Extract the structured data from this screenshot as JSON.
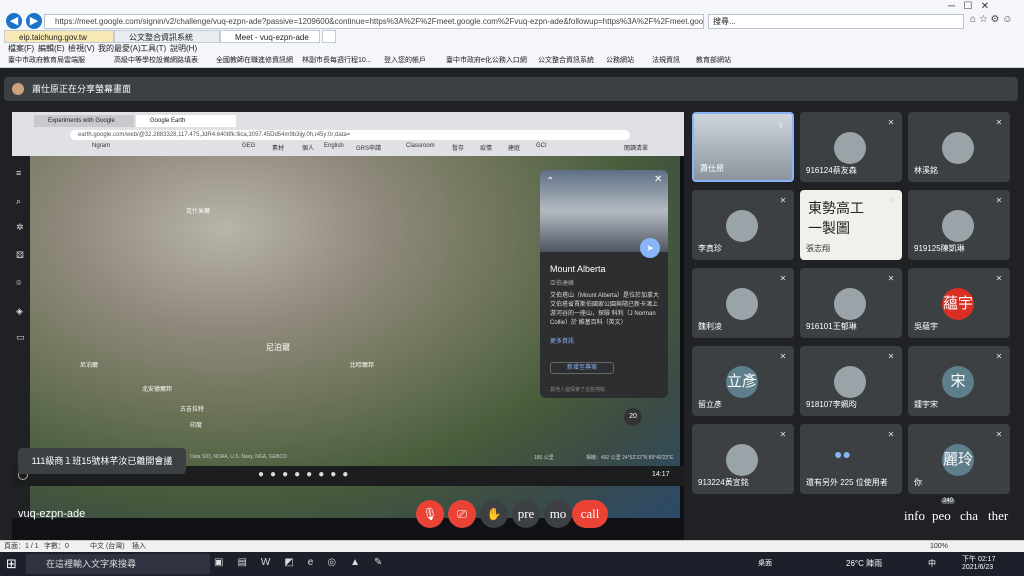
{
  "browser": {
    "url": "https://meet.google.com/signin/v2/challenge/vuq-ezpn-ade?passive=1209600&continue=https%3A%2F%2Fmeet.google.com%2Fvuq-ezpn-ade&followup=https%3A%2F%2Fmeet.google.com%2Fvuq-ezpn",
    "search_placeholder": "搜尋...",
    "tabs": [
      "eip.taichung.gov.tw",
      "公文整合資訊系統",
      "Meet - vuq-ezpn-ade"
    ],
    "menu": [
      "檔案(F)",
      "編輯(E)",
      "檢視(V)",
      "我的最愛(A)",
      "工具(T)",
      "說明(H)"
    ],
    "favorites": [
      "臺中市政府教育局雲端服",
      "高級中等學校設備網路填表",
      "全國教師在職進修資訊網",
      "林副市長每週行程10...",
      "登入您的帳戶",
      "臺中市政府e化公務入口網",
      "公文整合資訊系統",
      "公務網站",
      "法規資訊",
      "教育部網站"
    ]
  },
  "meet": {
    "sharing_banner": "蕭仕原正在分享螢幕畫面",
    "meeting_code": "vuq-ezpn-ade",
    "toast": "111級商１班15號林芊汝已離開會議",
    "controls": {
      "present": "pre",
      "more": "mo",
      "call": "call"
    },
    "right_labels": {
      "info": "info",
      "people": "peo",
      "chat": "cha",
      "others": "ther",
      "people_count": "240"
    }
  },
  "shared_screen": {
    "tabs": [
      "Experiments with Google",
      "Google Earth"
    ],
    "url": "earth.google.com/web/@32.2883328,117.475,JdR4.6408fk:llica,3057.45Dd54m9b3ijy,0h,r45y:0r;data=",
    "bookmarks": [
      "Ngram",
      "GEG",
      "素材",
      "個人",
      "English",
      "GRS申請",
      "Classroom",
      "暫存",
      "疫情",
      "建庭",
      "GCI",
      "閱讀清單"
    ],
    "map_labels": [
      "尼泊爾",
      "比哈爾邦",
      "北安德爾邦",
      "印度",
      "尼泊爾",
      "古吉拉特",
      "克什米爾"
    ],
    "card": {
      "title": "Mount Alberta",
      "subtitle": "亞伯達峰",
      "body": "艾伯塔山（Mount Alberta）是位於加拿大艾伯塔省賈斯伯國家公園與隨已新卡鴻上游河谷的一座山，探險 科利（J Norman Collie）於 維基百科（英文）",
      "more": "更多資訊",
      "add_btn": "新增至專案",
      "footer": "其他人還探索了這些地點"
    },
    "attribution": "Data SIO, NOAA, U.S. Navy, NGA, GEBCO",
    "scale": "180 公里",
    "coords": "相機：492 公里  24°52'22\"N 89°49'23\"E",
    "zoom_level": "20",
    "time": "14:17"
  },
  "participants": [
    {
      "name": "蕭仕原",
      "type": "video",
      "active": true
    },
    {
      "name": "916124蔡友森",
      "type": "photo"
    },
    {
      "name": "林溪銘",
      "type": "photo"
    },
    {
      "name": "李真珍",
      "type": "photo"
    },
    {
      "name": "張志翔",
      "type": "video",
      "content": "東勢高工\n一製圖"
    },
    {
      "name": "919125陳凱琳",
      "type": "photo"
    },
    {
      "name": "魏利凌",
      "type": "photo"
    },
    {
      "name": "916101王郁琳",
      "type": "photo"
    },
    {
      "name": "吳蘊宇",
      "type": "avatar",
      "initial": "蘊宇",
      "color": "#d93025"
    },
    {
      "name": "留立彥",
      "type": "avatar",
      "initial": "立彥",
      "color": "#5f7e8c"
    },
    {
      "name": "918107李姵昀",
      "type": "photo"
    },
    {
      "name": "鍾宇宋",
      "type": "avatar",
      "initial": "宋",
      "color": "#5f7e8c"
    },
    {
      "name": "913224黃宣銘",
      "type": "photo"
    },
    {
      "name": "還有另外 225 位使用者",
      "type": "group"
    },
    {
      "name": "你",
      "type": "avatar",
      "initial": "麗玲",
      "color": "#5f7e8c"
    }
  ],
  "ie_status": {
    "page": "頁面：1 / 1",
    "words": "字數：0",
    "lang": "中文 (台灣)",
    "mode": "插入",
    "zoom": "100%"
  },
  "windows": {
    "search": "在這裡輸入文字來搜尋",
    "weather": "26°C 陣雨",
    "ime": "中",
    "time": "下午 02:17",
    "date": "2021/6/23",
    "desktop": "桌面"
  }
}
